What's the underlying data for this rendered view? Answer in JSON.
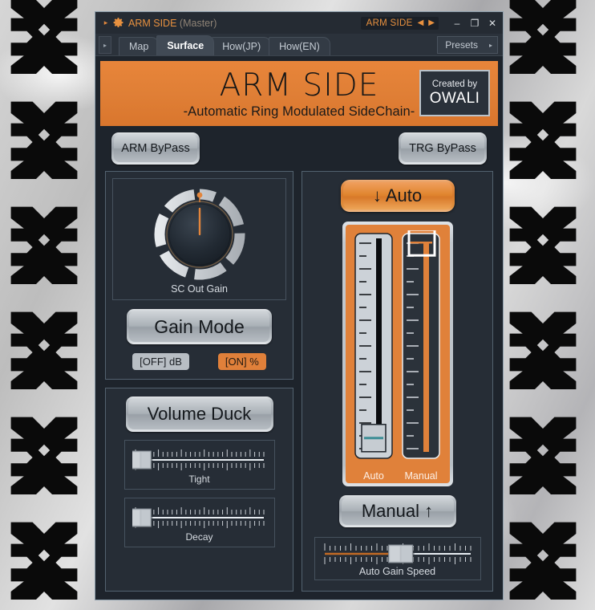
{
  "window": {
    "expand_arrow": "▸",
    "gear_icon": "gear-icon",
    "title": "ARM SIDE",
    "title_suffix": "(Master)",
    "preset_name": "ARM SIDE",
    "prev_icon": "◀",
    "next_icon": "▶",
    "minimize": "–",
    "maximize": "❐",
    "close": "✕"
  },
  "tabbar": {
    "side_arrow": "▸",
    "tabs": [
      {
        "label": "Map",
        "active": false
      },
      {
        "label": "Surface",
        "active": true
      },
      {
        "label": "How(JP)",
        "active": false
      },
      {
        "label": "How(EN)",
        "active": false
      }
    ],
    "presets_label": "Presets",
    "presets_arrow": "▸"
  },
  "banner": {
    "title": "ARM SIDE",
    "subtitle": "-Automatic Ring Modulated SideChain-",
    "credit_line1": "Created by",
    "credit_line2": "OWALI"
  },
  "bypass": {
    "arm_label": "ARM ByPass",
    "trg_label": "TRG ByPass"
  },
  "gain_section": {
    "knob_label": "SC Out Gain",
    "knob_value_deg": 0,
    "gain_mode_label": "Gain Mode",
    "mode_off_label": "[OFF] dB",
    "mode_on_label": "[ON] %"
  },
  "duck_section": {
    "title": "Volume Duck",
    "sliders": [
      {
        "label": "Tight",
        "value_pct": 4
      },
      {
        "label": "Decay",
        "value_pct": 4
      }
    ]
  },
  "right_section": {
    "auto_button": "↓ Auto",
    "manual_button": "Manual ↑",
    "faders": [
      {
        "label": "Auto",
        "value_pct": 9
      },
      {
        "label": "Manual",
        "value_pct": 96
      }
    ],
    "speed_slider": {
      "label": "Auto Gain Speed",
      "value_pct": 52
    }
  },
  "colors": {
    "accent_orange": "#e0813a",
    "panel_bg": "#262d36",
    "window_bg": "#1e242c",
    "titlebar_bg": "#252b33",
    "text_light": "#d8dde3",
    "banner_text": "#161616"
  }
}
